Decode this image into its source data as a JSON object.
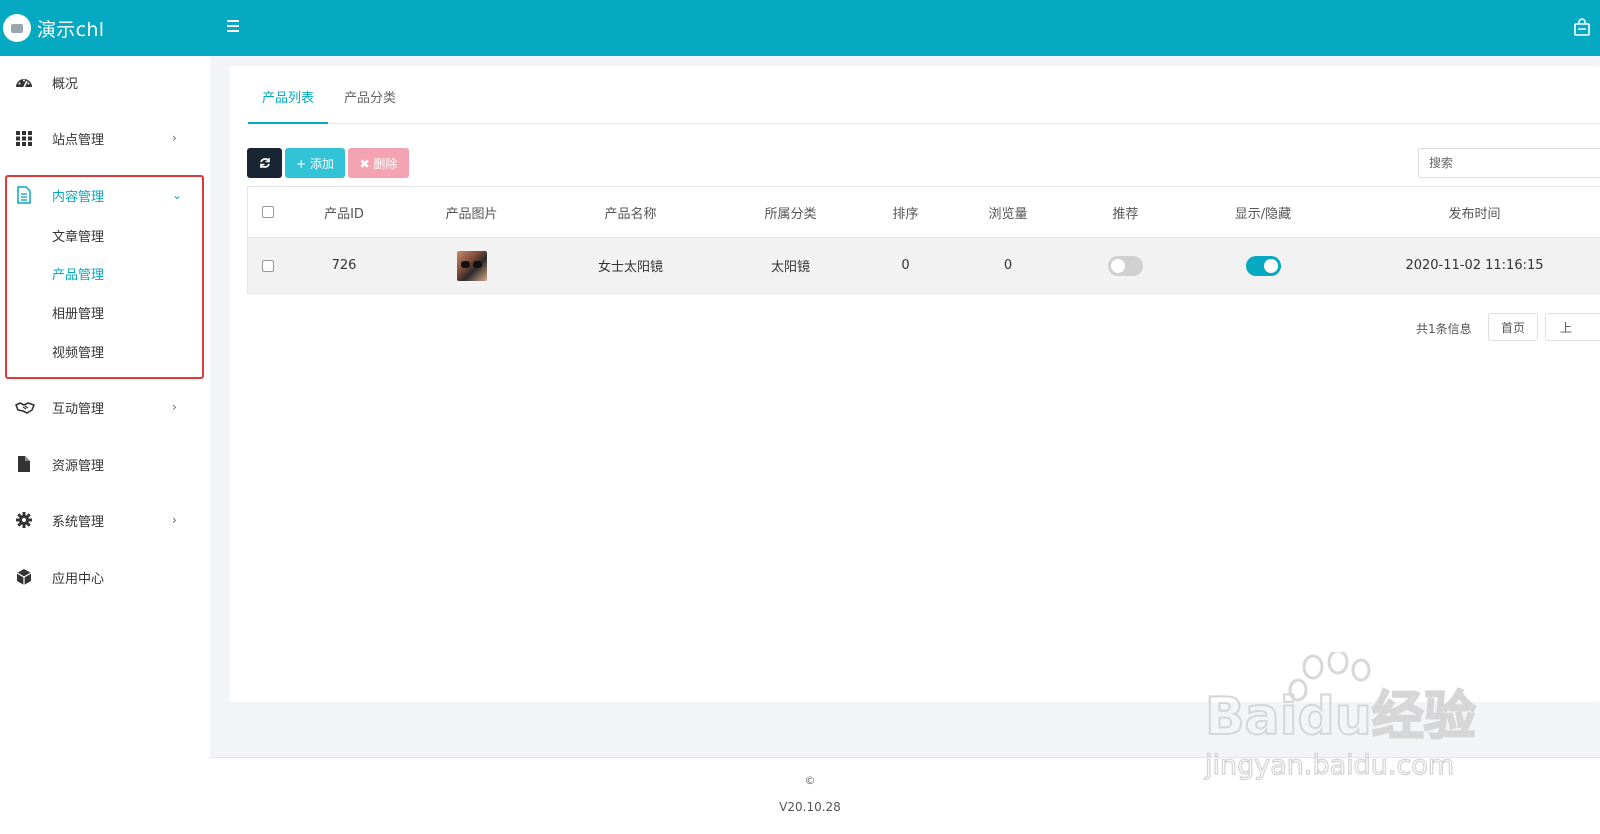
{
  "app": {
    "title": "演示chl"
  },
  "sidebar": {
    "items": [
      {
        "label": "概况",
        "icon": "dashboard-icon"
      },
      {
        "label": "站点管理",
        "icon": "grid-icon",
        "arrow": "›"
      },
      {
        "label": "内容管理",
        "icon": "document-icon",
        "arrow": "⌄"
      },
      {
        "label": "互动管理",
        "icon": "handshake-icon",
        "arrow": "›"
      },
      {
        "label": "资源管理",
        "icon": "file-icon"
      },
      {
        "label": "系统管理",
        "icon": "gear-icon",
        "arrow": "›"
      },
      {
        "label": "应用中心",
        "icon": "cube-icon"
      }
    ],
    "subitems": [
      {
        "label": "文章管理"
      },
      {
        "label": "产品管理"
      },
      {
        "label": "相册管理"
      },
      {
        "label": "视频管理"
      }
    ]
  },
  "tabs": [
    {
      "label": "产品列表"
    },
    {
      "label": "产品分类"
    }
  ],
  "toolbar": {
    "add_label": "+ 添加",
    "delete_label": "✖ 删除"
  },
  "search": {
    "placeholder": "搜索"
  },
  "table": {
    "headers": [
      "产品ID",
      "产品图片",
      "产品名称",
      "所属分类",
      "排序",
      "浏览量",
      "推荐",
      "显示/隐藏",
      "发布时间"
    ],
    "rows": [
      {
        "id": "726",
        "name": "女士太阳镜",
        "category": "太阳镜",
        "sort": "0",
        "views": "0",
        "recommend": false,
        "visible": true,
        "published": "2020-11-02 11:16:15"
      }
    ]
  },
  "pagination": {
    "total_text": "共1条信息",
    "first_label": "首页",
    "prev_label": "上"
  },
  "footer": {
    "copyright": "©",
    "version": "V20.10.28"
  },
  "watermark": {
    "brand": "Baidu经验",
    "url": "jingyan.baidu.com"
  },
  "colors": {
    "accent": "#05a9c1",
    "highlight_border": "#e0393b",
    "delete_button": "#f4a3b2",
    "refresh_button": "#1a2533"
  }
}
